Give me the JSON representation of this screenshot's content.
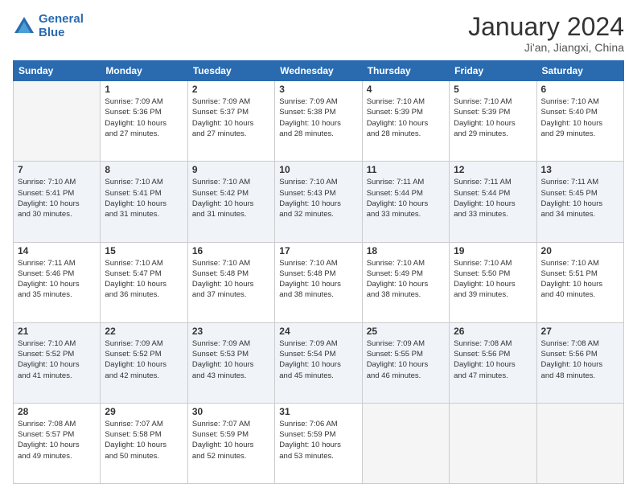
{
  "logo": {
    "line1": "General",
    "line2": "Blue"
  },
  "title": "January 2024",
  "subtitle": "Ji'an, Jiangxi, China",
  "headers": [
    "Sunday",
    "Monday",
    "Tuesday",
    "Wednesday",
    "Thursday",
    "Friday",
    "Saturday"
  ],
  "weeks": [
    [
      {
        "num": "",
        "info": ""
      },
      {
        "num": "1",
        "info": "Sunrise: 7:09 AM\nSunset: 5:36 PM\nDaylight: 10 hours\nand 27 minutes."
      },
      {
        "num": "2",
        "info": "Sunrise: 7:09 AM\nSunset: 5:37 PM\nDaylight: 10 hours\nand 27 minutes."
      },
      {
        "num": "3",
        "info": "Sunrise: 7:09 AM\nSunset: 5:38 PM\nDaylight: 10 hours\nand 28 minutes."
      },
      {
        "num": "4",
        "info": "Sunrise: 7:10 AM\nSunset: 5:39 PM\nDaylight: 10 hours\nand 28 minutes."
      },
      {
        "num": "5",
        "info": "Sunrise: 7:10 AM\nSunset: 5:39 PM\nDaylight: 10 hours\nand 29 minutes."
      },
      {
        "num": "6",
        "info": "Sunrise: 7:10 AM\nSunset: 5:40 PM\nDaylight: 10 hours\nand 29 minutes."
      }
    ],
    [
      {
        "num": "7",
        "info": "Sunrise: 7:10 AM\nSunset: 5:41 PM\nDaylight: 10 hours\nand 30 minutes."
      },
      {
        "num": "8",
        "info": "Sunrise: 7:10 AM\nSunset: 5:41 PM\nDaylight: 10 hours\nand 31 minutes."
      },
      {
        "num": "9",
        "info": "Sunrise: 7:10 AM\nSunset: 5:42 PM\nDaylight: 10 hours\nand 31 minutes."
      },
      {
        "num": "10",
        "info": "Sunrise: 7:10 AM\nSunset: 5:43 PM\nDaylight: 10 hours\nand 32 minutes."
      },
      {
        "num": "11",
        "info": "Sunrise: 7:11 AM\nSunset: 5:44 PM\nDaylight: 10 hours\nand 33 minutes."
      },
      {
        "num": "12",
        "info": "Sunrise: 7:11 AM\nSunset: 5:44 PM\nDaylight: 10 hours\nand 33 minutes."
      },
      {
        "num": "13",
        "info": "Sunrise: 7:11 AM\nSunset: 5:45 PM\nDaylight: 10 hours\nand 34 minutes."
      }
    ],
    [
      {
        "num": "14",
        "info": "Sunrise: 7:11 AM\nSunset: 5:46 PM\nDaylight: 10 hours\nand 35 minutes."
      },
      {
        "num": "15",
        "info": "Sunrise: 7:10 AM\nSunset: 5:47 PM\nDaylight: 10 hours\nand 36 minutes."
      },
      {
        "num": "16",
        "info": "Sunrise: 7:10 AM\nSunset: 5:48 PM\nDaylight: 10 hours\nand 37 minutes."
      },
      {
        "num": "17",
        "info": "Sunrise: 7:10 AM\nSunset: 5:48 PM\nDaylight: 10 hours\nand 38 minutes."
      },
      {
        "num": "18",
        "info": "Sunrise: 7:10 AM\nSunset: 5:49 PM\nDaylight: 10 hours\nand 38 minutes."
      },
      {
        "num": "19",
        "info": "Sunrise: 7:10 AM\nSunset: 5:50 PM\nDaylight: 10 hours\nand 39 minutes."
      },
      {
        "num": "20",
        "info": "Sunrise: 7:10 AM\nSunset: 5:51 PM\nDaylight: 10 hours\nand 40 minutes."
      }
    ],
    [
      {
        "num": "21",
        "info": "Sunrise: 7:10 AM\nSunset: 5:52 PM\nDaylight: 10 hours\nand 41 minutes."
      },
      {
        "num": "22",
        "info": "Sunrise: 7:09 AM\nSunset: 5:52 PM\nDaylight: 10 hours\nand 42 minutes."
      },
      {
        "num": "23",
        "info": "Sunrise: 7:09 AM\nSunset: 5:53 PM\nDaylight: 10 hours\nand 43 minutes."
      },
      {
        "num": "24",
        "info": "Sunrise: 7:09 AM\nSunset: 5:54 PM\nDaylight: 10 hours\nand 45 minutes."
      },
      {
        "num": "25",
        "info": "Sunrise: 7:09 AM\nSunset: 5:55 PM\nDaylight: 10 hours\nand 46 minutes."
      },
      {
        "num": "26",
        "info": "Sunrise: 7:08 AM\nSunset: 5:56 PM\nDaylight: 10 hours\nand 47 minutes."
      },
      {
        "num": "27",
        "info": "Sunrise: 7:08 AM\nSunset: 5:56 PM\nDaylight: 10 hours\nand 48 minutes."
      }
    ],
    [
      {
        "num": "28",
        "info": "Sunrise: 7:08 AM\nSunset: 5:57 PM\nDaylight: 10 hours\nand 49 minutes."
      },
      {
        "num": "29",
        "info": "Sunrise: 7:07 AM\nSunset: 5:58 PM\nDaylight: 10 hours\nand 50 minutes."
      },
      {
        "num": "30",
        "info": "Sunrise: 7:07 AM\nSunset: 5:59 PM\nDaylight: 10 hours\nand 52 minutes."
      },
      {
        "num": "31",
        "info": "Sunrise: 7:06 AM\nSunset: 5:59 PM\nDaylight: 10 hours\nand 53 minutes."
      },
      {
        "num": "",
        "info": ""
      },
      {
        "num": "",
        "info": ""
      },
      {
        "num": "",
        "info": ""
      }
    ]
  ]
}
